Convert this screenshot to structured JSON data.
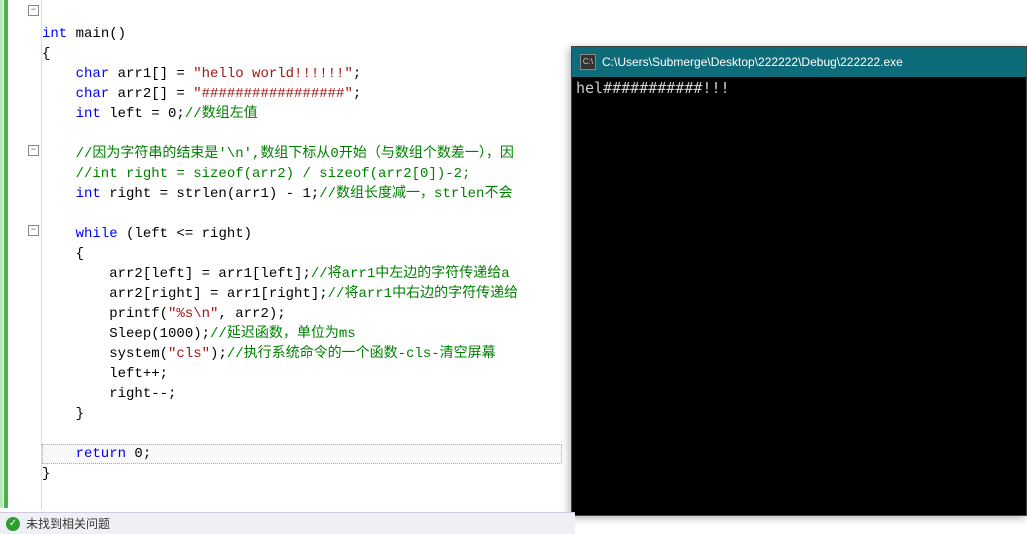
{
  "code": {
    "l1_kw": "int",
    "l1_rest": " main()",
    "l2": "{",
    "l3_kw": "    char",
    "l3_mid": " arr1[] = ",
    "l3_str": "\"hello world!!!!!!\"",
    "l3_end": ";",
    "l4_kw": "    char",
    "l4_mid": " arr2[] = ",
    "l4_str": "\"#################\"",
    "l4_end": ";",
    "l5_kw": "    int",
    "l5_mid": " left = 0;",
    "l5_cmt": "//数组左值",
    "l6": "",
    "l7_cmt": "    //因为字符串的结束是'\\n',数组下标从0开始（与数组个数差一），因",
    "l8_cmt": "    //int right = sizeof(arr2) / sizeof(arr2[0])-2;",
    "l9_kw": "    int",
    "l9_mid": " right = strlen(arr1) - 1;",
    "l9_cmt": "//数组长度减一，strlen不会",
    "l10": "",
    "l11_kw": "    while",
    "l11_mid": " (left <= right)",
    "l12": "    {",
    "l13_a": "        arr2[left] = arr1[left];",
    "l13_cmt": "//将arr1中左边的字符传递给a",
    "l14_a": "        arr2[right] = arr1[right];",
    "l14_cmt": "//将arr1中右边的字符传递给",
    "l15_a": "        printf(",
    "l15_str": "\"%s\\n\"",
    "l15_b": ", arr2);",
    "l16_a": "        Sleep(1000);",
    "l16_cmt": "//延迟函数，单位为ms",
    "l17_a": "        system(",
    "l17_str": "\"cls\"",
    "l17_b": ");",
    "l17_cmt": "//执行系统命令的一个函数-cls-清空屏幕",
    "l18": "        left++;",
    "l19": "        right--;",
    "l20": "    }",
    "l21": "",
    "l22_kw": "    return",
    "l22_mid": " 0;",
    "l23": "}"
  },
  "console": {
    "title": "C:\\Users\\Submerge\\Desktop\\222222\\Debug\\222222.exe",
    "icon": "C:\\",
    "output": "hel###########!!!"
  },
  "status": {
    "text": "未找到相关问题"
  }
}
